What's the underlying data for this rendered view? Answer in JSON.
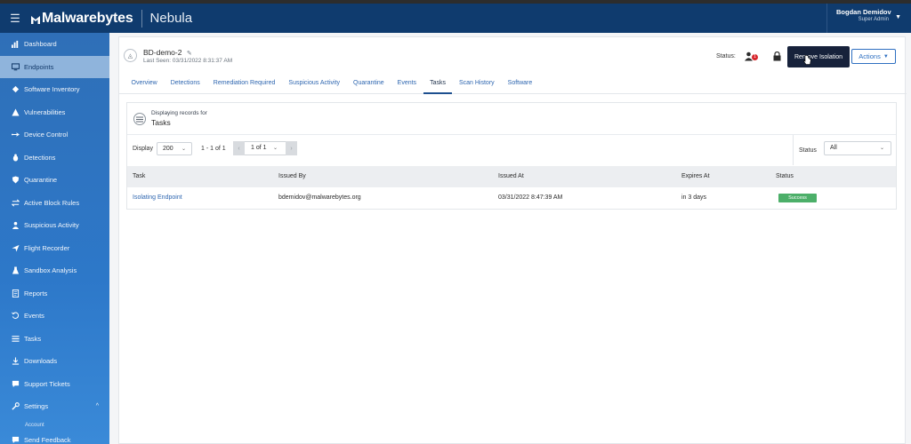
{
  "header": {
    "brand": "Malwarebytes",
    "product": "Nebula",
    "user_name": "Bogdan Demidov",
    "user_role": "Super Admin"
  },
  "sidebar": {
    "items": [
      {
        "label": "Dashboard",
        "icon": "bar-chart-icon"
      },
      {
        "label": "Endpoints",
        "icon": "monitor-icon",
        "active": true
      },
      {
        "label": "Software Inventory",
        "icon": "software-icon"
      },
      {
        "label": "Vulnerabilities",
        "icon": "warning-icon"
      },
      {
        "label": "Device Control",
        "icon": "usb-icon"
      },
      {
        "label": "Detections",
        "icon": "bug-icon"
      },
      {
        "label": "Quarantine",
        "icon": "shield-icon"
      },
      {
        "label": "Active Block Rules",
        "icon": "block-rules-icon"
      },
      {
        "label": "Suspicious Activity",
        "icon": "suspicious-icon"
      },
      {
        "label": "Flight Recorder",
        "icon": "flight-icon"
      },
      {
        "label": "Sandbox Analysis",
        "icon": "sandbox-icon"
      },
      {
        "label": "Reports",
        "icon": "report-icon"
      },
      {
        "label": "Events",
        "icon": "events-icon"
      },
      {
        "label": "Tasks",
        "icon": "tasks-icon"
      },
      {
        "label": "Downloads",
        "icon": "download-icon"
      },
      {
        "label": "Support Tickets",
        "icon": "support-icon"
      },
      {
        "label": "Settings",
        "icon": "wrench-icon"
      }
    ],
    "sub_partial": "Account",
    "send_feedback": "Send Feedback"
  },
  "device": {
    "name": "BD-demo-2",
    "last_seen": "Last Seen: 03/31/2022 8:31:37 AM",
    "status_label": "Status:",
    "status_badge": "1",
    "remove_isolation": "Remove Isolation",
    "actions": "Actions"
  },
  "tabs": [
    "Overview",
    "Detections",
    "Remediation Required",
    "Suspicious Activity",
    "Quarantine",
    "Events",
    "Tasks",
    "Scan History",
    "Software"
  ],
  "active_tab": "Tasks",
  "panel": {
    "displaying_label": "Displaying records for",
    "title": "Tasks",
    "display_label": "Display",
    "display_value": "200",
    "range": "1 - 1 of 1",
    "page_value": "1 of 1",
    "status_label": "Status",
    "status_value": "All"
  },
  "table": {
    "columns": [
      "Task",
      "Issued By",
      "Issued At",
      "Expires At",
      "Status"
    ],
    "rows": [
      {
        "task": "Isolating Endpoint",
        "issued_by": "bdemidov@malwarebytes.org",
        "issued_at": "03/31/2022 8:47:39 AM",
        "expires_at": "in 3 days",
        "status": "Success"
      }
    ]
  },
  "colors": {
    "topbar": "#0f3b6e",
    "sidebar": "#2f6fb7",
    "link": "#2e66b0",
    "success": "#4caf69",
    "dark_button": "#17223b"
  }
}
